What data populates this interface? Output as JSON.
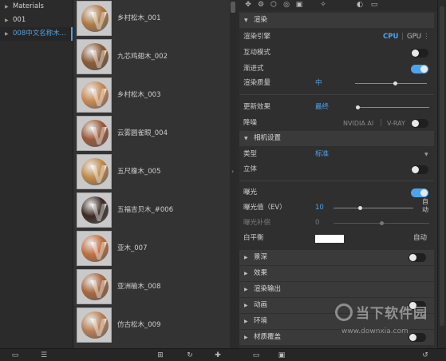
{
  "tree": {
    "items": [
      {
        "label": "Materials"
      },
      {
        "label": "001"
      },
      {
        "label": "008中文名称木..."
      }
    ]
  },
  "materials": [
    {
      "name": "乡村松木_001",
      "color": "#b07a45"
    },
    {
      "name": "九芯鸡翅木_002",
      "color": "#8a5a35"
    },
    {
      "name": "乡村松木_003",
      "color": "#c98a55"
    },
    {
      "name": "云雾圆雀眼_004",
      "color": "#9a5a3a"
    },
    {
      "name": "五尺橡木_005",
      "color": "#c08a4a"
    },
    {
      "name": "五福吉贝木_#006",
      "color": "#3a2a22"
    },
    {
      "name": "亚木_007",
      "color": "#c07040"
    },
    {
      "name": "亚洲榆木_008",
      "color": "#a86840"
    },
    {
      "name": "仿古松木_009",
      "color": "#b88055"
    }
  ],
  "render": {
    "section_title": "渲染",
    "engine_label": "渲染引擎",
    "cpu": "CPU",
    "gpu": "GPU",
    "interactive_label": "互动模式",
    "interactive_on": false,
    "progressive_label": "渐进式",
    "progressive_on": true,
    "quality_label": "渲染质量",
    "quality_value": "中",
    "quality_level": 0.55,
    "update_label": "更新效果",
    "update_value": "最终",
    "update_level": 0.0,
    "denoise_label": "降噪",
    "denoise_nvidia": "NVIDIA AI",
    "denoise_vray": "V-RAY",
    "denoise_on": false
  },
  "camera": {
    "section_title": "相机设置",
    "type_label": "类型",
    "type_value": "标准",
    "stereo_label": "立体",
    "stereo_on": false,
    "exposure_label": "曝光",
    "exposure_on": true,
    "ev_label": "曝光值（EV）",
    "ev_value": "10",
    "ev_auto": "自动",
    "ev_level": 0.33,
    "comp_label": "曝光补偿",
    "comp_value": "0",
    "comp_level": 0.5,
    "wb_label": "白平衡",
    "wb_color": "#ffffff",
    "wb_auto": "自动"
  },
  "sections": [
    {
      "label": "景深",
      "toggle": true,
      "on": false
    },
    {
      "label": "效果",
      "toggle": false
    },
    {
      "label": "渲染输出",
      "toggle": false
    },
    {
      "label": "动画",
      "toggle": true,
      "on": false
    },
    {
      "label": "环境",
      "toggle": false
    },
    {
      "label": "材质覆盖",
      "toggle": true,
      "on": false
    }
  ],
  "watermark": {
    "text": "当下软件园",
    "url": "www.downxia.com"
  },
  "colors": {
    "accent": "#4fa3ea"
  }
}
